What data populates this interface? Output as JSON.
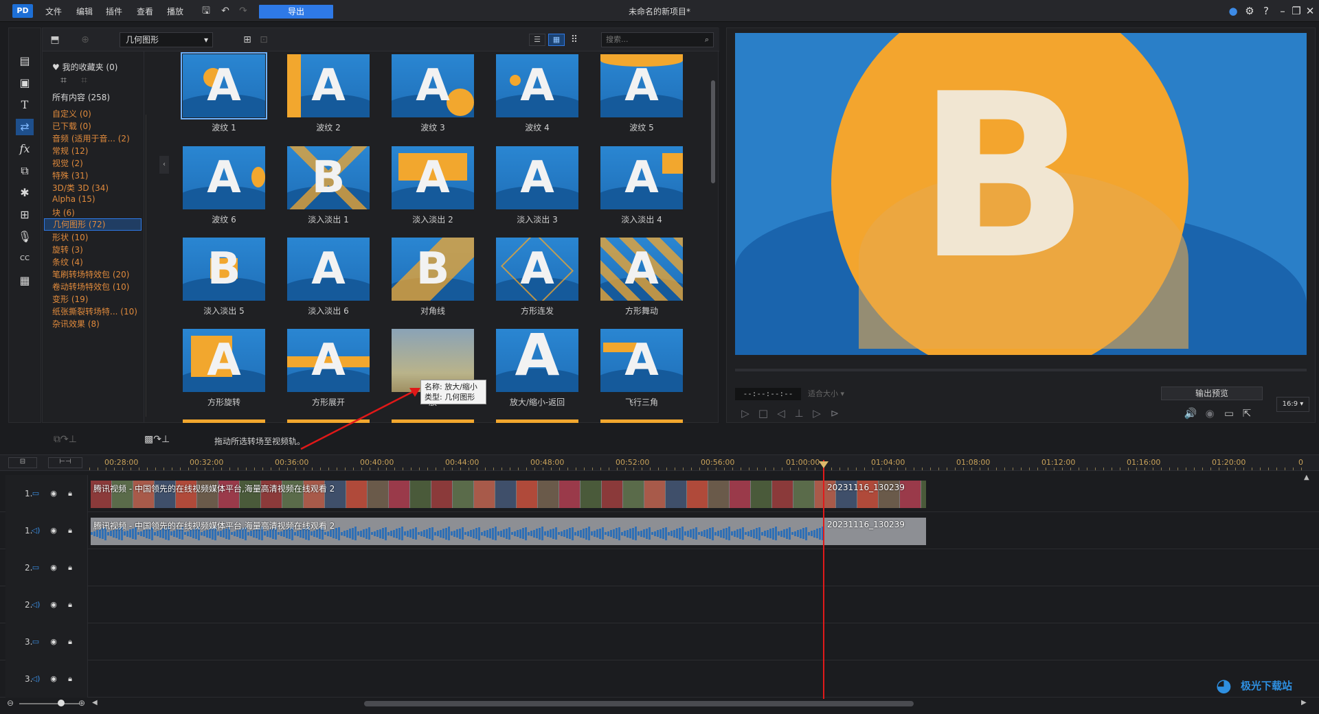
{
  "app": {
    "logo_text": "PD",
    "project_title": "未命名的新项目*",
    "menu": [
      "文件",
      "编辑",
      "插件",
      "查看",
      "播放"
    ],
    "export_label": "导出",
    "window_controls": [
      "notification-icon",
      "gear-icon",
      "help-icon",
      "minimize-icon",
      "restore-icon",
      "close-icon"
    ]
  },
  "library": {
    "category_selected": "几何图形",
    "search_placeholder": "搜索...",
    "favorites": "我的收藏夹 (0)",
    "all_content": "所有内容 (258)",
    "categories": [
      {
        "label": "自定义  (0)"
      },
      {
        "label": "已下载  (0)"
      },
      {
        "label": "音频 (适用于音...  (2)"
      },
      {
        "label": "常规  (12)"
      },
      {
        "label": "视觉  (2)"
      },
      {
        "label": "特殊  (31)"
      },
      {
        "label": "3D/类 3D  (34)"
      },
      {
        "label": "Alpha  (15)"
      },
      {
        "label": "块  (6)"
      },
      {
        "label": "几何图形  (72)"
      },
      {
        "label": "形状  (10)"
      },
      {
        "label": "旋转  (3)"
      },
      {
        "label": "条纹  (4)"
      },
      {
        "label": "笔刷转场特效包  (20)"
      },
      {
        "label": "卷动转场特效包  (10)"
      },
      {
        "label": "变形  (19)"
      },
      {
        "label": "纸张撕裂转场特...  (10)"
      },
      {
        "label": "杂讯效果  (8)"
      }
    ],
    "transitions": [
      {
        "label": "波纹 1",
        "letter": "A"
      },
      {
        "label": "波纹 2",
        "letter": "A"
      },
      {
        "label": "波纹 3",
        "letter": "A"
      },
      {
        "label": "波纹 4",
        "letter": "A"
      },
      {
        "label": "波纹 5",
        "letter": "A"
      },
      {
        "label": "波纹 6",
        "letter": "A"
      },
      {
        "label": "淡入淡出 1",
        "letter": "B"
      },
      {
        "label": "淡入淡出 2",
        "letter": "A"
      },
      {
        "label": "淡入淡出 3",
        "letter": "A"
      },
      {
        "label": "淡入淡出 4",
        "letter": "A"
      },
      {
        "label": "淡入淡出 5",
        "letter": "B"
      },
      {
        "label": "淡入淡出 6",
        "letter": "A"
      },
      {
        "label": "对角线",
        "letter": "B"
      },
      {
        "label": "方形连发",
        "letter": "A"
      },
      {
        "label": "方形舞动",
        "letter": "A"
      },
      {
        "label": "方形旋转",
        "letter": "A"
      },
      {
        "label": "方形展开",
        "letter": "A"
      },
      {
        "label": "放",
        "letter": ""
      },
      {
        "label": "放大/缩小-返回",
        "letter": "A"
      },
      {
        "label": "飞行三角",
        "letter": "A"
      }
    ],
    "tooltip": {
      "name": "名称: 放大/缩小",
      "type": "类型: 几何图形"
    }
  },
  "preview": {
    "timecode": "--:--:--:--",
    "fit_label": "适合大小",
    "output_preview_label": "输出预览",
    "aspect_label": "16:9",
    "preview_letter": "B"
  },
  "timeline": {
    "hint": "拖动所选转场至视频轨。",
    "ruler_labels": [
      "00:28:00",
      "00:32:00",
      "00:36:00",
      "00:40:00",
      "00:44:00",
      "00:48:00",
      "00:52:00",
      "00:56:00",
      "01:00:00",
      "01:04:00",
      "01:08:00",
      "01:12:00",
      "01:16:00",
      "01:20:00",
      "0"
    ],
    "tracks": [
      {
        "label": "1.",
        "kind": "video"
      },
      {
        "label": "1.",
        "kind": "audio"
      },
      {
        "label": "2.",
        "kind": "video"
      },
      {
        "label": "2.",
        "kind": "audio"
      },
      {
        "label": "3.",
        "kind": "video"
      },
      {
        "label": "3.",
        "kind": "audio"
      }
    ],
    "clip_main_label": "腾讯视频 - 中国领先的在线视频媒体平台,海量高清视频在线观看 2",
    "clip_second_label": "20231116_130239"
  },
  "watermark": "极光下载站"
}
